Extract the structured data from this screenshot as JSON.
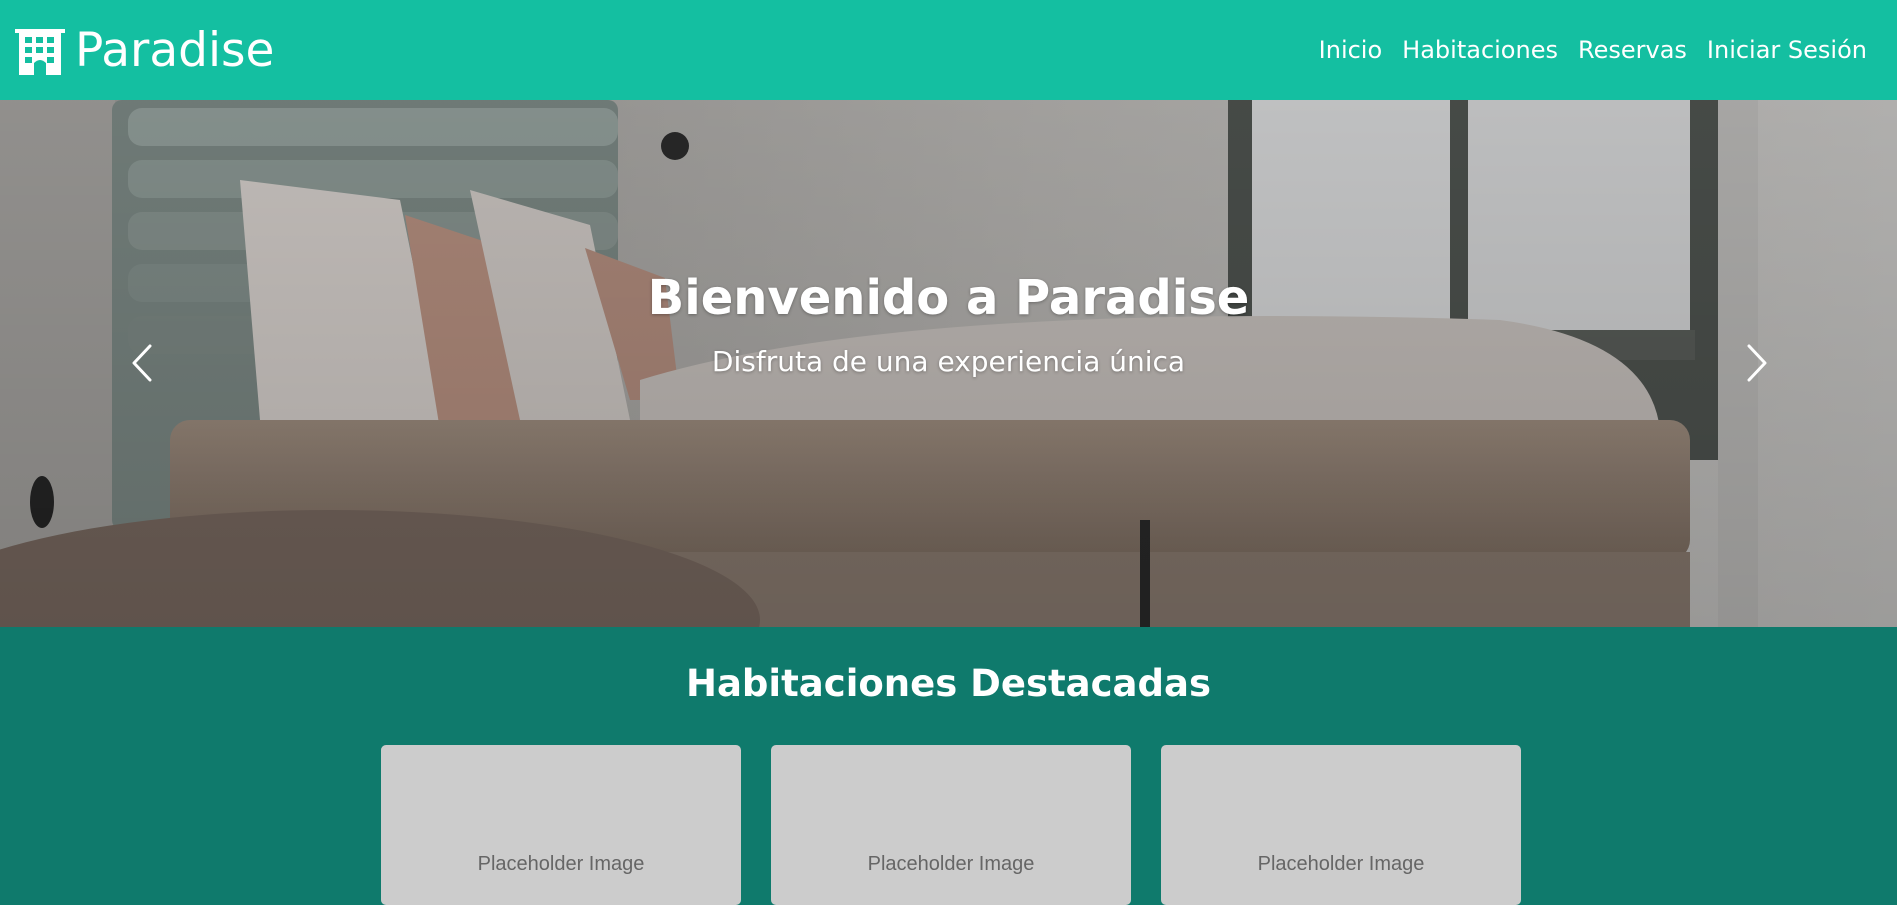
{
  "brand": {
    "name": "Paradise",
    "icon": "hotel-building-icon"
  },
  "nav": {
    "items": [
      {
        "label": "Inicio"
      },
      {
        "label": "Habitaciones"
      },
      {
        "label": "Reservas"
      },
      {
        "label": "Iniciar Sesión"
      }
    ]
  },
  "hero": {
    "title": "Bienvenido a Paradise",
    "subtitle": "Disfruta de una experiencia única",
    "prev_icon": "chevron-left-icon",
    "next_icon": "chevron-right-icon"
  },
  "featured": {
    "title": "Habitaciones Destacadas",
    "cards": [
      {
        "image_label": "Placeholder Image"
      },
      {
        "image_label": "Placeholder Image"
      },
      {
        "image_label": "Placeholder Image"
      }
    ]
  },
  "colors": {
    "navbar": "#14bfa1",
    "section": "#0f7a6c",
    "card_placeholder": "#cccccc"
  }
}
